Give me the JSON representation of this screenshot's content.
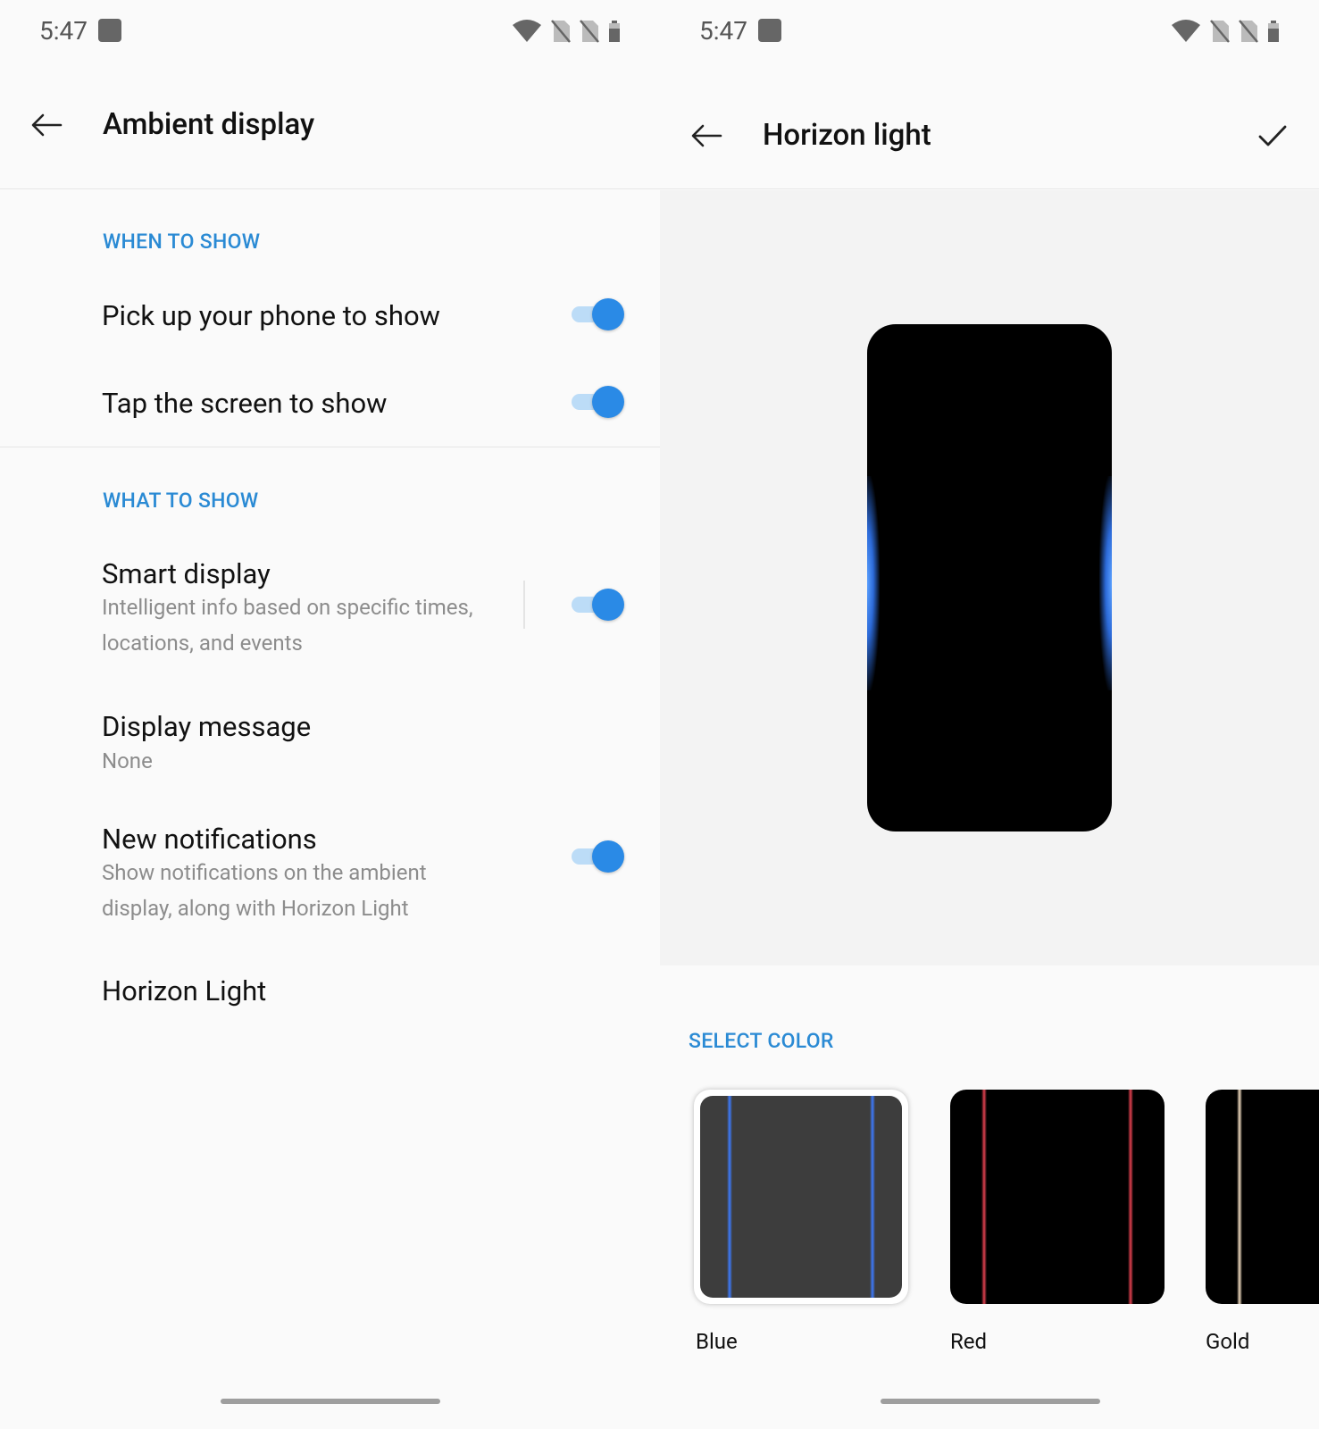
{
  "left": {
    "status": {
      "time": "5:47"
    },
    "appbar": {
      "title": "Ambient display"
    },
    "when_to_show": {
      "header": "WHEN TO SHOW",
      "items": [
        {
          "title": "Pick up your phone to show",
          "enabled": true
        },
        {
          "title": "Tap the screen to show",
          "enabled": true
        }
      ]
    },
    "what_to_show": {
      "header": "WHAT TO SHOW",
      "smart_display": {
        "title": "Smart display",
        "sub1": "Intelligent info based on specific times,",
        "sub2": "locations, and events",
        "enabled": true
      },
      "display_message": {
        "title": "Display message",
        "value": "None"
      },
      "new_notifications": {
        "title": "New notifications",
        "sub1": "Show notifications on the ambient",
        "sub2": "display, along with Horizon Light",
        "enabled": true
      },
      "horizon_light": {
        "title": "Horizon Light"
      }
    }
  },
  "right": {
    "status": {
      "time": "5:47"
    },
    "appbar": {
      "title": "Horizon light"
    },
    "select_color": {
      "header": "SELECT COLOR",
      "options": [
        {
          "label": "Blue",
          "color": "#3d7bff",
          "selected": true
        },
        {
          "label": "Red",
          "color": "#e0414f",
          "selected": false
        },
        {
          "label": "Gold",
          "color": "#f1dcc0",
          "selected": false
        }
      ]
    }
  },
  "colors": {
    "accent": "#2a8ad4",
    "toggle_on": "#2a8ae6"
  }
}
